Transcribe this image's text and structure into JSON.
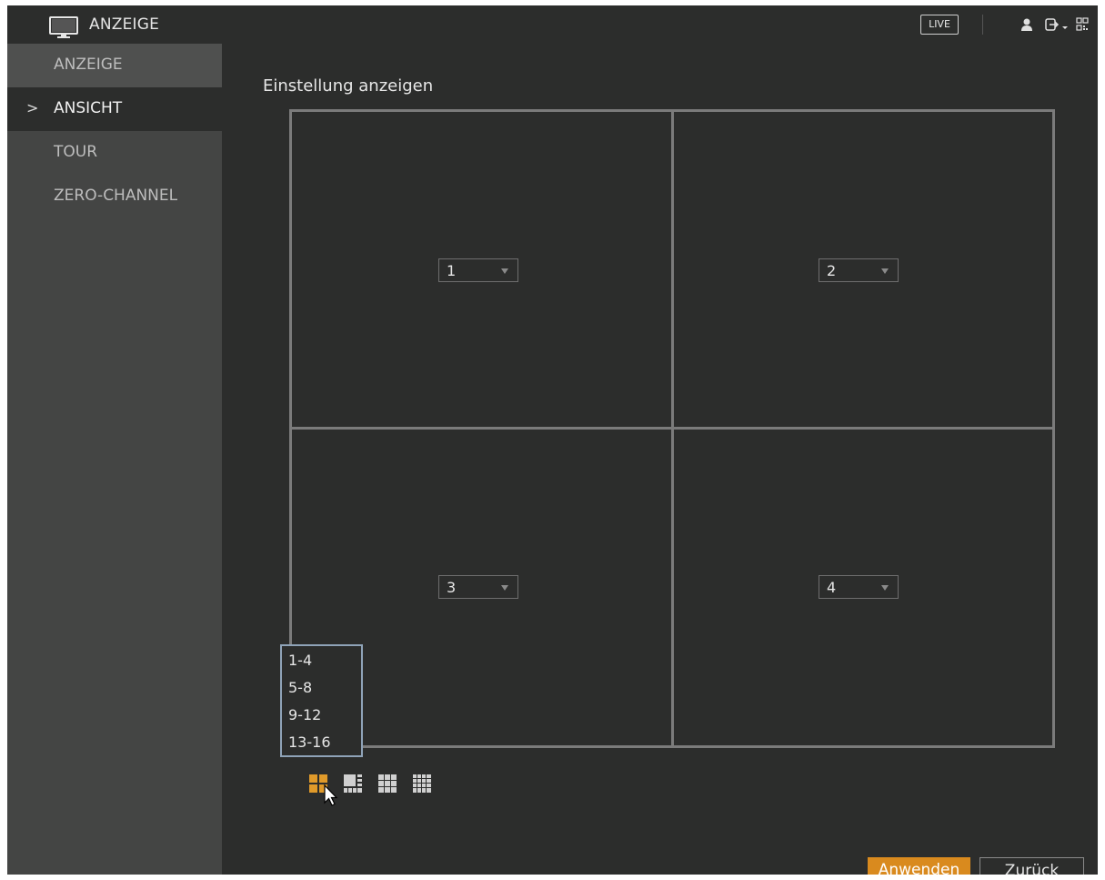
{
  "header": {
    "title": "ANZEIGE",
    "live_label": "LIVE",
    "icons": [
      "monitor-icon",
      "user-icon",
      "logout-icon",
      "qr-code-icon"
    ]
  },
  "sidebar": {
    "items": [
      {
        "label": "ANZEIGE",
        "active": false
      },
      {
        "label": "ANSICHT",
        "active": true,
        "marker": ">"
      },
      {
        "label": "TOUR",
        "active": false
      },
      {
        "label": "ZERO-CHANNEL",
        "active": false
      }
    ]
  },
  "main": {
    "section_title": "Einstellung anzeigen",
    "cells": [
      {
        "channel": "1"
      },
      {
        "channel": "2"
      },
      {
        "channel": "3"
      },
      {
        "channel": "4"
      }
    ],
    "group_dropdown": {
      "options": [
        "1-4",
        "5-8",
        "9-12",
        "13-16"
      ]
    },
    "split_modes": [
      {
        "name": "split-4",
        "selected": true
      },
      {
        "name": "split-8",
        "selected": false
      },
      {
        "name": "split-9",
        "selected": false
      },
      {
        "name": "split-16",
        "selected": false
      }
    ]
  },
  "footer": {
    "apply_label": "Anwenden",
    "back_label": "Zurück"
  },
  "colors": {
    "accent": "#d98a1e",
    "background": "#2c2d2c",
    "sidebar": "#444544",
    "grid_line": "#7b7b7b"
  }
}
